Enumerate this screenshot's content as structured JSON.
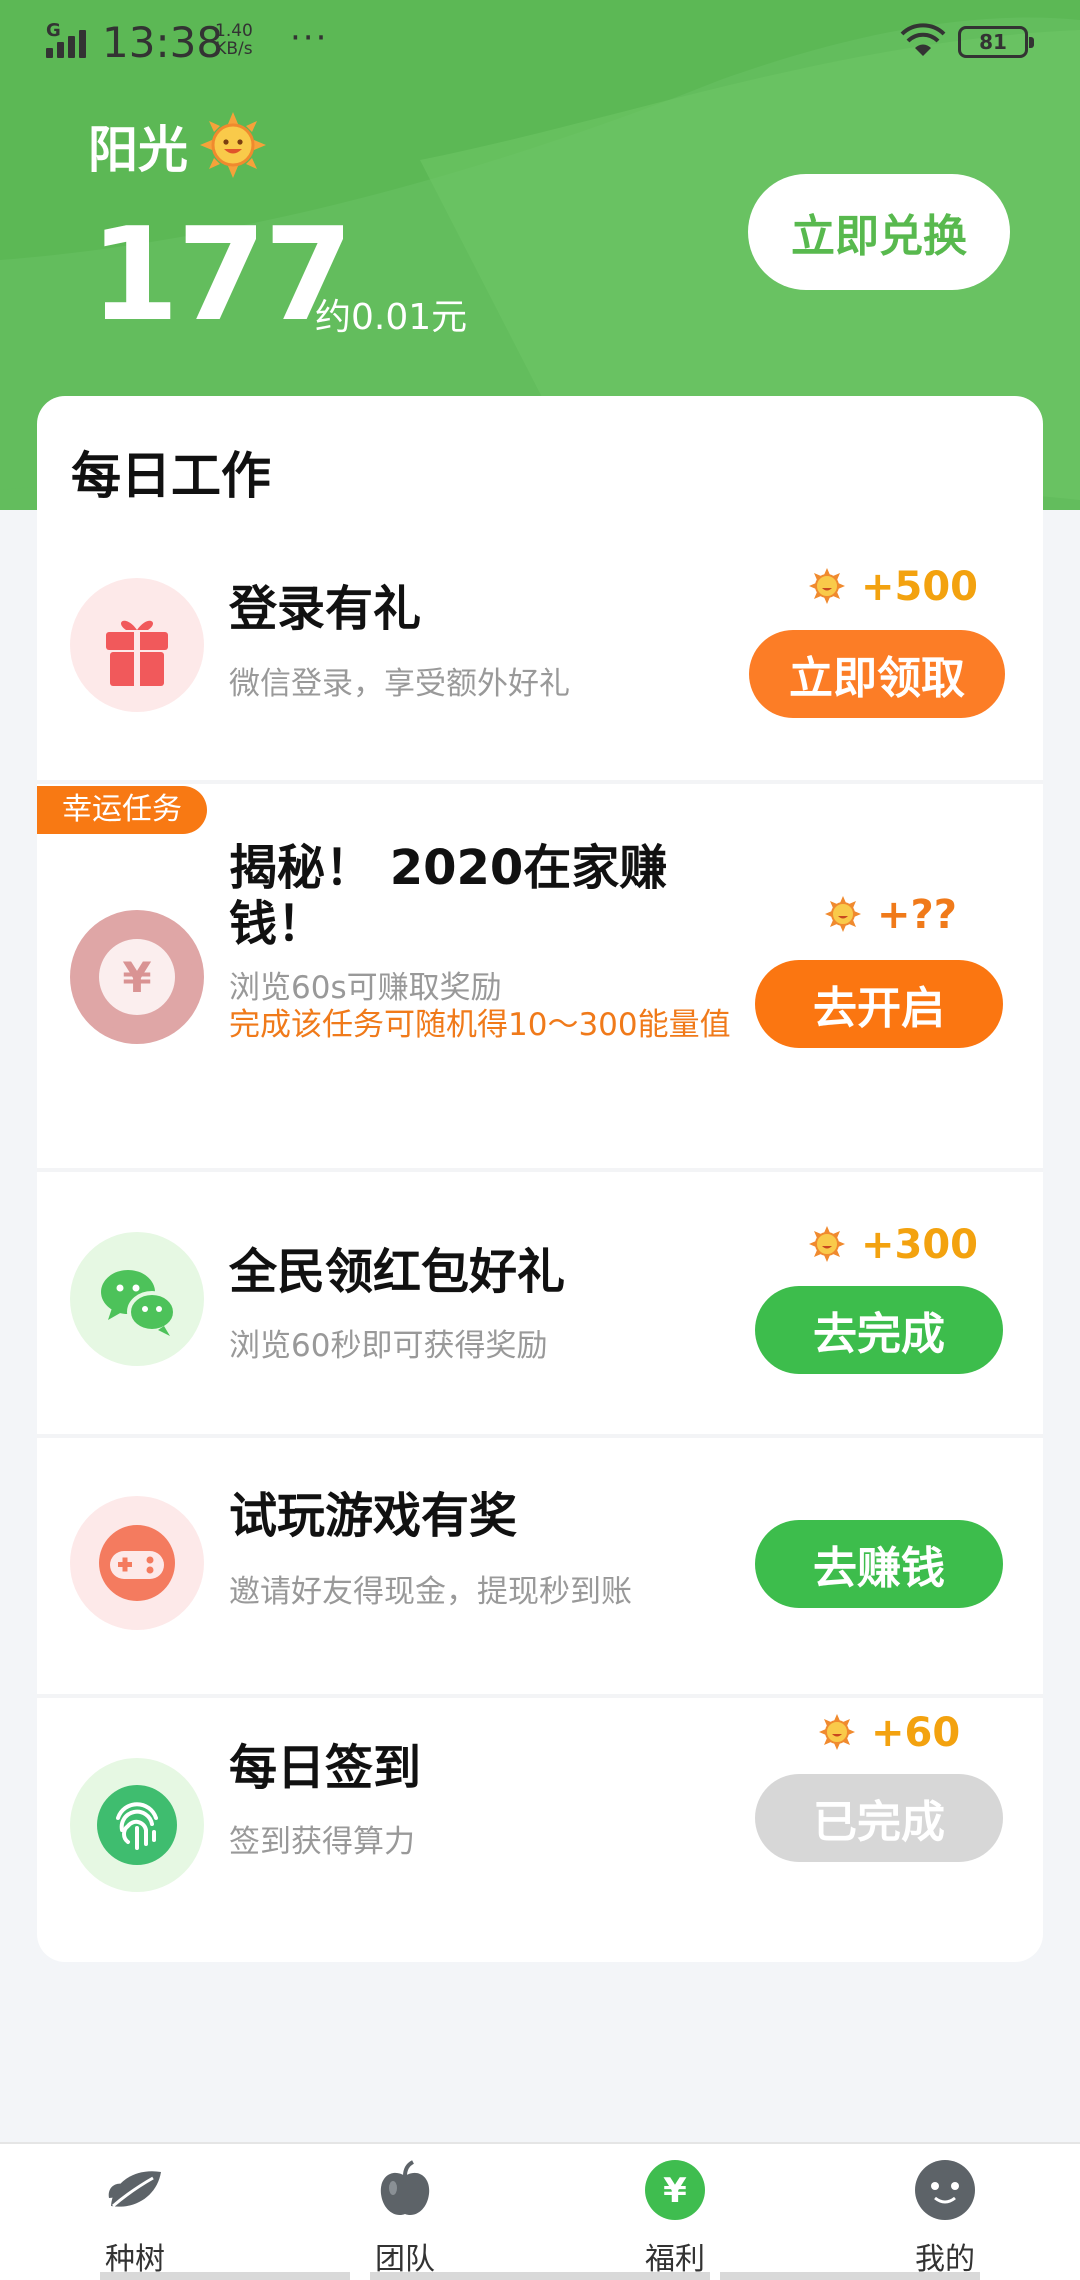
{
  "status_bar": {
    "network": "G",
    "time": "13:38",
    "speed_value": "1.40",
    "speed_unit": "KB/s",
    "more": "···",
    "battery": "81"
  },
  "header": {
    "username": "阳光",
    "points": "177",
    "approx_value": "约0.01元",
    "redeem_label": "立即兑换",
    "colors": {
      "green": "#63bd5d",
      "green_light": "#74c86a"
    }
  },
  "daily": {
    "title": "每日工作",
    "tasks": [
      {
        "title": "登录有礼",
        "desc": "微信登录，享受额外好礼",
        "reward": "+500",
        "button": "立即领取",
        "icon": "gift-icon"
      },
      {
        "badge": "幸运任务",
        "title": "揭秘！ 2020在家赚钱！",
        "desc": "浏览60s可赚取奖励",
        "note": "完成该任务可随机得10～300能量值",
        "reward": "+??",
        "button": "去开启",
        "icon": "yuan-coin-icon"
      },
      {
        "title": "全民领红包好礼",
        "desc": "浏览60秒即可获得奖励",
        "reward": "+300",
        "button": "去完成",
        "icon": "wechat-icon"
      },
      {
        "title": "试玩游戏有奖",
        "desc": "邀请好友得现金，提现秒到账",
        "button": "去赚钱",
        "icon": "gamepad-icon"
      },
      {
        "title": "每日签到",
        "desc": "签到获得算力",
        "reward": "+60",
        "button": "已完成",
        "icon": "fingerprint-icon"
      }
    ]
  },
  "tabbar": {
    "tabs": [
      {
        "label": "种树",
        "icon": "leaf-icon"
      },
      {
        "label": "团队",
        "icon": "apple-icon"
      },
      {
        "label": "福利",
        "icon": "yen-icon",
        "active": true
      },
      {
        "label": "我的",
        "icon": "smiley-icon"
      }
    ]
  }
}
